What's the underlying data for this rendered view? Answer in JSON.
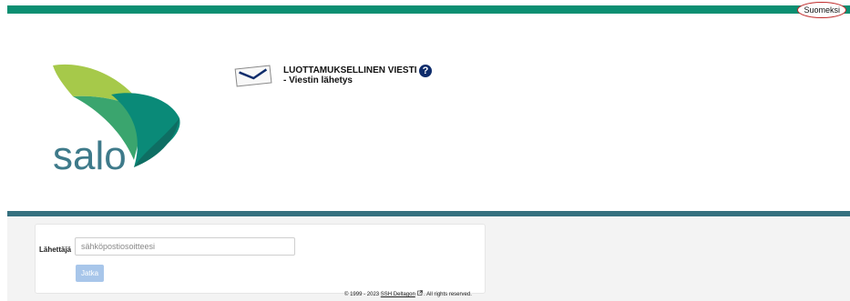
{
  "header": {
    "language": "Suomeksi",
    "title": "LUOTTAMUKSELLINEN VIESTI",
    "subtitle": "- Viestin lähetys",
    "help_symbol": "?"
  },
  "logo": {
    "text": "salo"
  },
  "form": {
    "sender_label": "Lähettäjä",
    "sender_placeholder": "sähköpostiosoitteesi",
    "sender_value": "",
    "continue_label": "Jatka"
  },
  "footer": {
    "copyright": "© 1999 - 2023",
    "company": "SSH Deltagon",
    "rights": ". All rights reserved."
  },
  "colors": {
    "top_bar": "#0b8f72",
    "divider": "#35707f",
    "button": "#a8c6ea",
    "help": "#0e2c6b"
  },
  "icons": {
    "envelope": "envelope-icon",
    "help": "question-icon",
    "external": "external-link-icon"
  }
}
